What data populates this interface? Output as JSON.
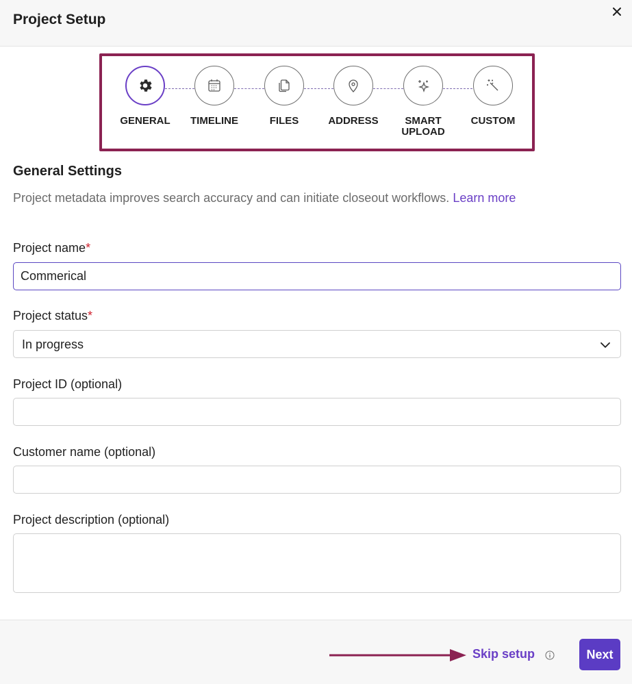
{
  "dialog": {
    "title": "Project Setup",
    "close_icon": "close-icon"
  },
  "stepper": {
    "steps": [
      {
        "label": "GENERAL",
        "icon": "gear-icon",
        "active": true
      },
      {
        "label": "TIMELINE",
        "icon": "calendar-icon",
        "active": false
      },
      {
        "label": "FILES",
        "icon": "files-icon",
        "active": false
      },
      {
        "label": "ADDRESS",
        "icon": "location-pin-icon",
        "active": false
      },
      {
        "label": "SMART UPLOAD",
        "icon": "sparkles-icon",
        "active": false
      },
      {
        "label": "CUSTOM",
        "icon": "magic-wand-icon",
        "active": false
      }
    ]
  },
  "section": {
    "title": "General Settings",
    "description": "Project metadata improves search accuracy and can initiate closeout workflows.",
    "learn_more": "Learn more"
  },
  "fields": {
    "project_name": {
      "label": "Project name",
      "required": "*",
      "value": "Commerical"
    },
    "project_status": {
      "label": "Project status",
      "required": "*",
      "value": "In progress"
    },
    "project_id": {
      "label": "Project ID (optional)",
      "value": ""
    },
    "customer_name": {
      "label": "Customer name (optional)",
      "value": ""
    },
    "project_description": {
      "label": "Project description (optional)",
      "value": ""
    }
  },
  "footer": {
    "skip_label": "Skip setup",
    "next_label": "Next"
  },
  "colors": {
    "accent": "#5b3cc4",
    "annotation": "#8b2252",
    "required": "#d0232f"
  }
}
